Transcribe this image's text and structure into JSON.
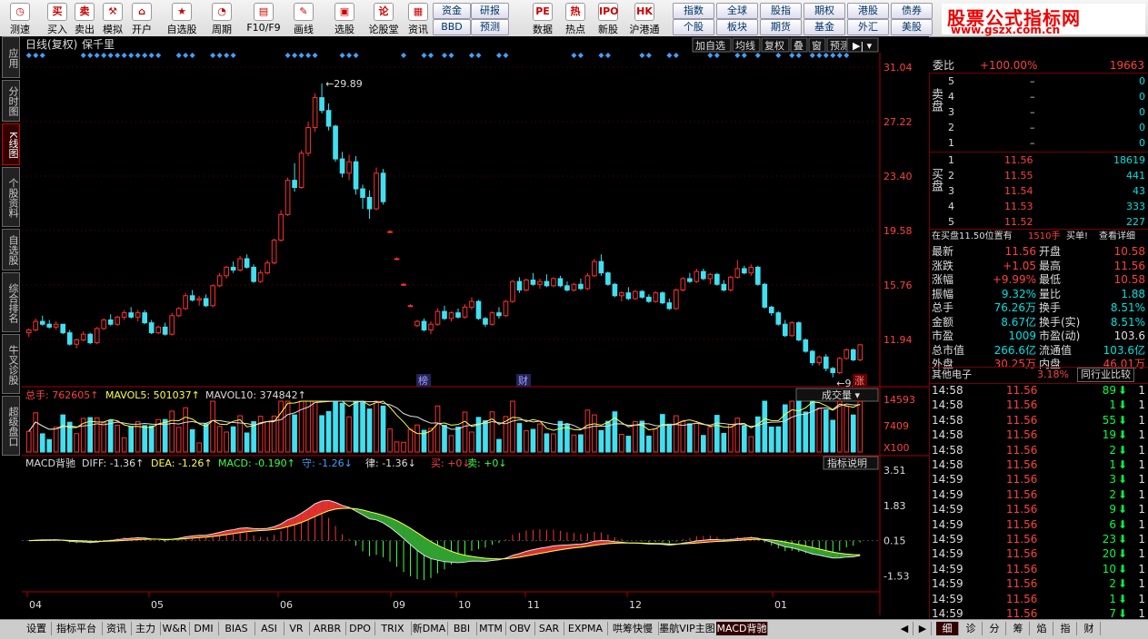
{
  "toolbar": {
    "tools": [
      {
        "label": "测速",
        "icon": "clock-icon",
        "glyph": "◷"
      },
      {
        "label": "买入",
        "icon": "buy-icon",
        "glyph": "买"
      },
      {
        "label": "卖出",
        "icon": "sell-icon",
        "glyph": "卖"
      },
      {
        "label": "模拟",
        "icon": "gavel-icon",
        "glyph": "⚒"
      },
      {
        "label": "开户",
        "icon": "lock-icon",
        "glyph": "⌂"
      },
      {
        "label": "自选股",
        "icon": "star-icon",
        "glyph": "★"
      },
      {
        "label": "周期",
        "icon": "cycle-icon",
        "glyph": "◔"
      },
      {
        "label": "F10/F9",
        "icon": "info-icon",
        "glyph": "▤"
      },
      {
        "label": "画线",
        "icon": "pen-icon",
        "glyph": "✎"
      },
      {
        "label": "选股",
        "icon": "screen-icon",
        "glyph": "▣"
      },
      {
        "label": "论股堂",
        "icon": "forum-icon",
        "glyph": "论"
      },
      {
        "label": "资讯",
        "icon": "news-icon",
        "glyph": "▦"
      },
      {
        "label": "数据",
        "icon": "pe-icon",
        "glyph": "PE"
      },
      {
        "label": "热点",
        "icon": "hot-icon",
        "glyph": "热"
      },
      {
        "label": "新股",
        "icon": "ipo-icon",
        "glyph": "IPO"
      },
      {
        "label": "沪港通",
        "icon": "sse-hk-icon",
        "glyph": "HK"
      }
    ],
    "mid_buttons": [
      "资金",
      "研报",
      "BBD",
      "预测"
    ],
    "right_buttons": [
      "指数",
      "全球",
      "股指",
      "期权",
      "港股",
      "债券",
      "个股",
      "板块",
      "期货",
      "基金",
      "外汇",
      "美股"
    ]
  },
  "logo": {
    "title": "股票公式指标网",
    "url": "www.gszx.com.cn"
  },
  "left_tabs": [
    "应用",
    "分时图",
    "K线图",
    "个股资料",
    "自选股",
    "综合排名",
    "牛叉诊股",
    "超级盘口"
  ],
  "chart_header": {
    "title": "日线(复权)",
    "stock": "保千里",
    "buttons": [
      "加自选",
      "均线",
      "复权",
      "叠",
      "窗",
      "预测"
    ]
  },
  "chart_data": {
    "type": "candlestick",
    "y_ticks": [
      "31.04",
      "27.22",
      "23.40",
      "19.58",
      "15.76",
      "11.94"
    ],
    "x_ticks": [
      "04",
      "05",
      "06",
      "09",
      "10",
      "11",
      "12",
      "01"
    ],
    "high_label": "29.89",
    "low_label": "9.27",
    "event_labels": [
      "榜",
      "财",
      "涨"
    ],
    "candles": [
      [
        12.4,
        12.7,
        12.1,
        12.6
      ],
      [
        12.6,
        13.4,
        12.5,
        13.2
      ],
      [
        13.2,
        13.6,
        12.9,
        13.0
      ],
      [
        13.0,
        13.3,
        12.7,
        12.8
      ],
      [
        12.8,
        13.2,
        12.6,
        13.0
      ],
      [
        13.0,
        13.0,
        12.3,
        12.4
      ],
      [
        12.4,
        12.6,
        11.5,
        11.6
      ],
      [
        11.6,
        12.0,
        11.3,
        11.9
      ],
      [
        11.9,
        12.5,
        11.8,
        12.3
      ],
      [
        12.3,
        12.4,
        11.6,
        11.7
      ],
      [
        11.7,
        12.8,
        11.6,
        12.7
      ],
      [
        12.7,
        13.4,
        12.6,
        13.3
      ],
      [
        13.3,
        13.7,
        12.9,
        13.0
      ],
      [
        13.0,
        13.6,
        12.9,
        13.5
      ],
      [
        13.5,
        14.0,
        13.3,
        13.8
      ],
      [
        13.8,
        14.2,
        13.4,
        13.5
      ],
      [
        13.5,
        14.0,
        13.2,
        13.8
      ],
      [
        13.8,
        14.0,
        13.0,
        13.1
      ],
      [
        13.1,
        13.3,
        12.3,
        12.4
      ],
      [
        12.4,
        12.9,
        12.3,
        12.8
      ],
      [
        12.8,
        13.1,
        12.2,
        12.3
      ],
      [
        12.3,
        13.8,
        12.2,
        13.6
      ],
      [
        13.6,
        14.2,
        13.5,
        14.1
      ],
      [
        14.1,
        15.2,
        14.0,
        15.0
      ],
      [
        15.0,
        15.4,
        14.6,
        14.7
      ],
      [
        14.7,
        15.0,
        14.3,
        14.8
      ],
      [
        14.8,
        15.1,
        14.2,
        14.3
      ],
      [
        14.3,
        15.8,
        14.2,
        15.7
      ],
      [
        15.7,
        16.6,
        15.6,
        16.4
      ],
      [
        16.4,
        17.1,
        16.2,
        17.0
      ],
      [
        17.0,
        17.4,
        16.6,
        16.8
      ],
      [
        16.8,
        17.8,
        16.7,
        17.6
      ],
      [
        17.6,
        17.9,
        16.9,
        17.0
      ],
      [
        17.0,
        17.2,
        15.9,
        16.0
      ],
      [
        16.0,
        16.8,
        15.9,
        16.6
      ],
      [
        16.6,
        17.5,
        16.5,
        17.3
      ],
      [
        17.3,
        19.0,
        17.2,
        18.9
      ],
      [
        18.9,
        21.0,
        18.8,
        20.7
      ],
      [
        20.7,
        23.3,
        20.6,
        23.1
      ],
      [
        23.1,
        24.3,
        22.3,
        22.6
      ],
      [
        22.6,
        25.2,
        22.5,
        25.0
      ],
      [
        25.0,
        27.2,
        24.8,
        26.8
      ],
      [
        26.8,
        29.2,
        26.5,
        28.9
      ],
      [
        28.9,
        29.9,
        27.8,
        28.0
      ],
      [
        28.0,
        28.5,
        26.6,
        26.9
      ],
      [
        26.9,
        27.0,
        24.4,
        24.6
      ],
      [
        24.6,
        25.1,
        23.3,
        23.6
      ],
      [
        23.6,
        24.9,
        23.1,
        24.4
      ],
      [
        24.4,
        24.8,
        22.1,
        22.5
      ],
      [
        22.5,
        22.8,
        21.1,
        21.9
      ],
      [
        21.9,
        22.4,
        20.4,
        21.1
      ],
      [
        21.1,
        24.0,
        21.0,
        23.6
      ],
      [
        23.6,
        23.9,
        21.4,
        21.6
      ],
      [
        19.5,
        19.6,
        19.4,
        19.5
      ],
      [
        17.6,
        17.7,
        17.5,
        17.6
      ],
      [
        15.8,
        15.9,
        15.7,
        15.8
      ],
      [
        14.3,
        14.4,
        14.2,
        14.3
      ],
      [
        12.9,
        13.3,
        12.8,
        13.2
      ],
      [
        13.2,
        13.4,
        12.5,
        12.6
      ],
      [
        12.6,
        13.2,
        12.3,
        13.0
      ],
      [
        13.0,
        14.1,
        12.9,
        13.9
      ],
      [
        13.9,
        14.3,
        13.3,
        13.4
      ],
      [
        13.4,
        13.9,
        13.2,
        13.8
      ],
      [
        13.8,
        14.1,
        13.4,
        13.5
      ],
      [
        13.5,
        14.4,
        13.4,
        14.2
      ],
      [
        14.2,
        14.9,
        14.0,
        14.6
      ],
      [
        14.6,
        14.7,
        13.3,
        13.4
      ],
      [
        13.4,
        13.5,
        12.8,
        13.0
      ],
      [
        13.0,
        13.9,
        12.9,
        13.8
      ],
      [
        13.8,
        14.2,
        13.4,
        13.6
      ],
      [
        13.6,
        14.7,
        13.5,
        14.6
      ],
      [
        14.6,
        16.1,
        14.5,
        16.0
      ],
      [
        16.0,
        16.3,
        15.2,
        15.4
      ],
      [
        15.4,
        16.2,
        15.3,
        16.1
      ],
      [
        16.1,
        16.6,
        15.7,
        15.8
      ],
      [
        15.8,
        16.2,
        15.5,
        16.0
      ],
      [
        16.0,
        16.5,
        15.6,
        15.7
      ],
      [
        15.7,
        16.3,
        15.6,
        16.2
      ],
      [
        16.2,
        16.4,
        15.6,
        15.7
      ],
      [
        15.7,
        16.0,
        15.3,
        15.4
      ],
      [
        15.4,
        15.9,
        15.3,
        15.8
      ],
      [
        15.8,
        16.2,
        15.4,
        15.5
      ],
      [
        15.5,
        16.6,
        15.4,
        16.4
      ],
      [
        16.4,
        17.6,
        16.3,
        17.4
      ],
      [
        17.4,
        17.9,
        16.4,
        16.6
      ],
      [
        16.6,
        16.7,
        15.7,
        15.8
      ],
      [
        15.8,
        15.9,
        14.9,
        15.0
      ],
      [
        15.0,
        15.3,
        14.6,
        15.2
      ],
      [
        15.2,
        15.6,
        14.7,
        14.8
      ],
      [
        14.8,
        15.4,
        14.7,
        15.3
      ],
      [
        15.3,
        15.4,
        14.8,
        14.9
      ],
      [
        14.9,
        15.1,
        14.5,
        14.6
      ],
      [
        14.6,
        15.3,
        14.5,
        15.2
      ],
      [
        15.2,
        15.3,
        14.4,
        14.5
      ],
      [
        14.5,
        14.8,
        14.0,
        14.1
      ],
      [
        14.1,
        15.5,
        14.0,
        15.4
      ],
      [
        15.4,
        16.3,
        15.3,
        16.2
      ],
      [
        16.2,
        16.6,
        15.9,
        16.0
      ],
      [
        16.0,
        16.9,
        15.9,
        16.7
      ],
      [
        16.7,
        16.9,
        16.1,
        16.2
      ],
      [
        16.2,
        16.6,
        15.8,
        16.5
      ],
      [
        16.5,
        16.6,
        15.7,
        15.8
      ],
      [
        15.8,
        16.1,
        15.3,
        15.4
      ],
      [
        15.4,
        16.4,
        15.3,
        16.3
      ],
      [
        16.3,
        17.5,
        16.2,
        16.9
      ],
      [
        16.9,
        17.1,
        16.5,
        16.6
      ],
      [
        16.6,
        17.2,
        16.4,
        17.0
      ],
      [
        17.0,
        17.1,
        15.7,
        15.8
      ],
      [
        15.8,
        15.9,
        14.1,
        14.2
      ],
      [
        14.2,
        14.3,
        13.6,
        13.8
      ],
      [
        13.8,
        13.9,
        12.9,
        13.0
      ],
      [
        13.0,
        13.3,
        12.1,
        12.2
      ],
      [
        12.2,
        13.2,
        12.1,
        13.1
      ],
      [
        13.1,
        13.2,
        11.8,
        11.9
      ],
      [
        11.9,
        12.0,
        11.0,
        11.1
      ],
      [
        11.1,
        11.2,
        10.1,
        10.3
      ],
      [
        10.3,
        10.8,
        10.1,
        10.7
      ],
      [
        10.7,
        10.9,
        9.7,
        9.9
      ],
      [
        9.9,
        10.0,
        9.27,
        9.6
      ],
      [
        9.6,
        10.7,
        9.5,
        10.6
      ],
      [
        10.6,
        11.3,
        10.5,
        11.2
      ],
      [
        11.2,
        11.3,
        10.4,
        10.5
      ],
      [
        10.5,
        11.6,
        10.4,
        11.56
      ]
    ],
    "volume": {
      "label": "总手",
      "value": "762605",
      "ma5_label": "MAVOL5",
      "ma5": "501037",
      "ma10_label": "MAVOL10",
      "ma10": "374842",
      "ticks": [
        "14593",
        "7409",
        "X100"
      ],
      "selector": "成交量"
    },
    "macd": {
      "label": "MACD背驰",
      "diff": "DIFF: -1.36",
      "dea": "DEA: -1.26",
      "macd": "MACD: -0.190",
      "shou": "守: -1.26",
      "lv": "律: -1.36",
      "buy": "买: +0",
      "sell": "卖: +0",
      "ticks": [
        "3.51",
        "1.83",
        "0.15",
        "-1.53"
      ],
      "explain": "指标说明"
    }
  },
  "quote": {
    "weibi_label": "委比",
    "weibi": "+100.00%",
    "weibi_vol": "19663",
    "sell_label": "卖盘",
    "buy_label": "买盘",
    "sells": [
      [
        "5",
        "–",
        "0"
      ],
      [
        "4",
        "–",
        "0"
      ],
      [
        "3",
        "–",
        "0"
      ],
      [
        "2",
        "–",
        "0"
      ],
      [
        "1",
        "–",
        "0"
      ]
    ],
    "buys": [
      [
        "1",
        "11.56",
        "18619"
      ],
      [
        "2",
        "11.55",
        "441"
      ],
      [
        "3",
        "11.54",
        "43"
      ],
      [
        "4",
        "11.53",
        "333"
      ],
      [
        "5",
        "11.52",
        "227"
      ]
    ],
    "notice_a": "在买盘11.50位置有",
    "notice_b": "1510手",
    "notice_c": "买单!",
    "notice_link": "查看详细",
    "stats": [
      [
        "最新",
        "11.56",
        "开盘",
        "10.58"
      ],
      [
        "涨跌",
        "+1.05",
        "最高",
        "11.56"
      ],
      [
        "涨幅",
        "+9.99%",
        "最低",
        "10.58"
      ],
      [
        "振幅",
        "9.32%",
        "量比",
        "1.88"
      ],
      [
        "总手",
        "76.26万",
        "换手",
        "8.51%"
      ],
      [
        "金额",
        "8.67亿",
        "换手(实)",
        "8.51%"
      ],
      [
        "市盈",
        "1009",
        "市盈(动)",
        "103.6"
      ],
      [
        "总市值",
        "266.6亿",
        "流通值",
        "103.6亿"
      ],
      [
        "外盘",
        "30.25万",
        "内盘",
        "46.01万"
      ]
    ],
    "sector_label": "其他电子",
    "sector_pct": "3.18%",
    "sector_btn": "同行业比较",
    "ticks": [
      [
        "14:58",
        "11.56",
        "89"
      ],
      [
        "14:58",
        "11.56",
        "1"
      ],
      [
        "14:58",
        "11.56",
        "55"
      ],
      [
        "14:58",
        "11.56",
        "19"
      ],
      [
        "14:58",
        "11.56",
        "2"
      ],
      [
        "14:58",
        "11.56",
        "1"
      ],
      [
        "14:59",
        "11.56",
        "3"
      ],
      [
        "14:59",
        "11.56",
        "2"
      ],
      [
        "14:59",
        "11.56",
        "9"
      ],
      [
        "14:59",
        "11.56",
        "6"
      ],
      [
        "14:59",
        "11.56",
        "23"
      ],
      [
        "14:59",
        "11.56",
        "20"
      ],
      [
        "14:59",
        "11.56",
        "10"
      ],
      [
        "14:59",
        "11.56",
        "2"
      ],
      [
        "14:59",
        "11.56",
        "1"
      ],
      [
        "14:59",
        "11.56",
        "7"
      ]
    ]
  },
  "bottom_tabs": [
    "设置",
    "指标平台",
    "资讯",
    "主力",
    "W&R",
    "DMI",
    "BIAS",
    "ASI",
    "VR",
    "ARBR",
    "DPO",
    "TRIX",
    "新DMA",
    "BBI",
    "MTM",
    "OBV",
    "SAR",
    "EXPMA",
    "哄筹快慢",
    "墨航VIP主图",
    "MACD背驰"
  ],
  "bottom_right_tabs": [
    "细",
    "诊",
    "分",
    "筹",
    "焰",
    "指",
    "财"
  ]
}
